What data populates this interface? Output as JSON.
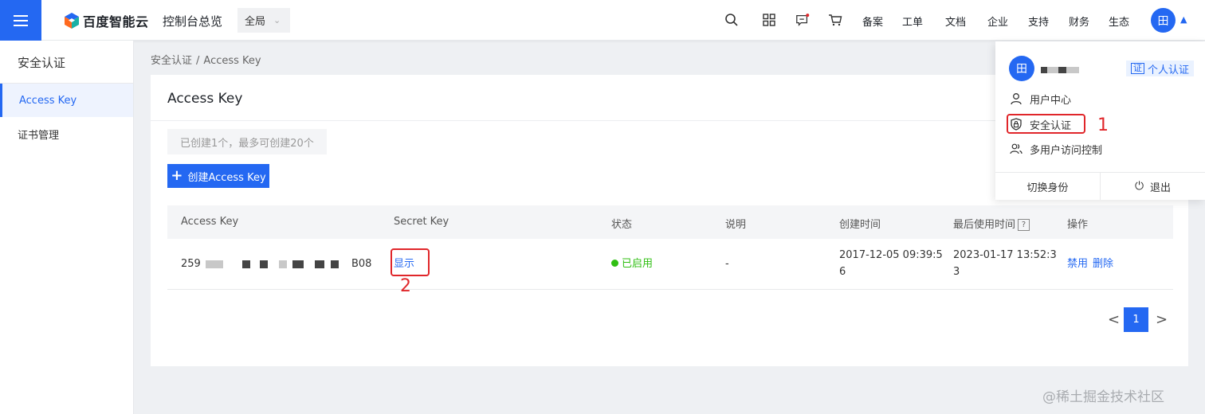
{
  "header": {
    "brand": "百度智能云",
    "console_title": "控制台总览",
    "region": "全局",
    "nav": [
      "备案",
      "工单",
      "文档",
      "企业",
      "支持",
      "财务",
      "生态"
    ],
    "avatar_initial": "田",
    "icons": [
      "search-icon",
      "apps-grid-icon",
      "message-icon",
      "cart-icon"
    ]
  },
  "sidebar": {
    "title": "安全认证",
    "items": [
      {
        "label": "Access Key",
        "active": true
      },
      {
        "label": "证书管理",
        "active": false
      }
    ]
  },
  "breadcrumb": {
    "parent": "安全认证",
    "separator": "/",
    "current": "Access Key"
  },
  "main": {
    "title": "Access Key",
    "limit_tip": "已创建1个，最多可创建20个",
    "create_button": "创建Access Key",
    "table": {
      "columns": [
        "Access Key",
        "Secret Key",
        "状态",
        "说明",
        "创建时间",
        "最后使用时间",
        "操作"
      ],
      "help_mark": "?",
      "rows": [
        {
          "access_key_prefix": "259",
          "access_key_suffix": "B08",
          "secret_action": "显示",
          "status": "已启用",
          "description": "-",
          "created_line1": "2017-12-05 09:39:5",
          "created_line2": "6",
          "last_used_line1": "2023-01-17 13:52:3",
          "last_used_line2": "3",
          "actions": [
            "禁用",
            "删除"
          ]
        }
      ]
    },
    "pagination": {
      "prev": "<",
      "current": "1",
      "next": ">"
    }
  },
  "user_menu": {
    "avatar_initial": "田",
    "verify_badge": "证",
    "verify_label": "个人认证",
    "items": [
      "用户中心",
      "安全认证",
      "多用户访问控制"
    ],
    "switch_identity": "切换身份",
    "logout": "退出"
  },
  "annotations": {
    "step1": "1",
    "step2": "2"
  },
  "watermark": "@稀土掘金技术社区",
  "colors": {
    "primary": "#2468f2",
    "success": "#30bf13",
    "annotation": "#e0262a"
  }
}
